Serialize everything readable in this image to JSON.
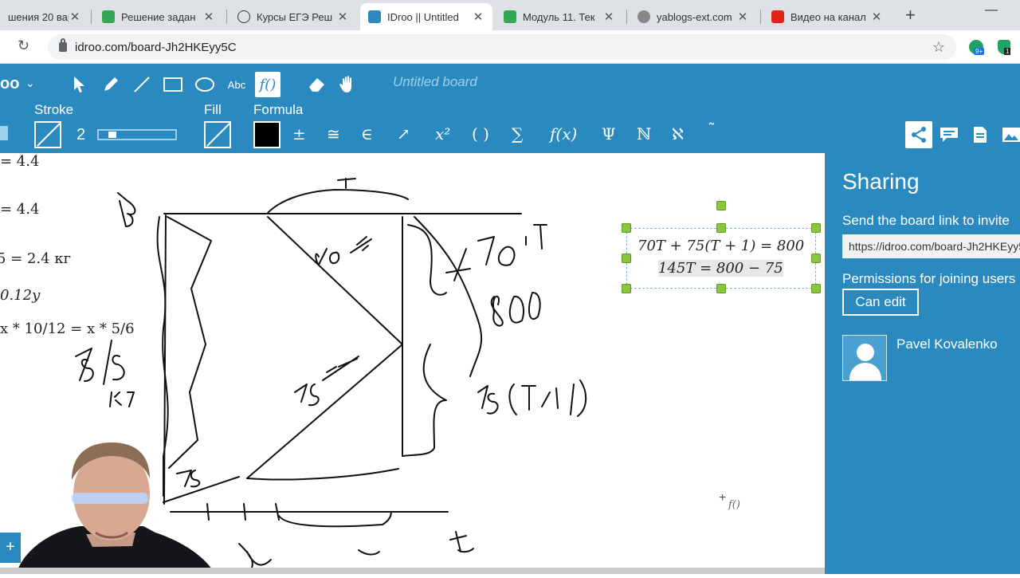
{
  "browser": {
    "tabs": [
      {
        "title": "шения 20 вар",
        "active": false
      },
      {
        "title": "Решение задан",
        "active": false
      },
      {
        "title": "Курсы ЕГЭ Реш",
        "active": false
      },
      {
        "title": "IDroo || Untitled",
        "active": true
      },
      {
        "title": "Модуль 11. Тек",
        "active": false
      },
      {
        "title": "yablogs-ext.com",
        "active": false
      },
      {
        "title": "Видео на канал",
        "active": false
      }
    ],
    "url": "idroo.com/board-Jh2HKEyy5C",
    "ext1_badge": "9+",
    "ext2_badge": "1"
  },
  "toolbar": {
    "logo": "oo",
    "text_tool": "Abc",
    "formula_tool": "f()",
    "board_title": "Untitled board",
    "stroke_label": "Stroke",
    "fill_label": "Fill",
    "formula_label": "Formula",
    "stroke_width": "2",
    "stroke_width_fraction": 0.1,
    "fill_color": "#000000",
    "symbols": [
      "±",
      "≅",
      "∈",
      "↗",
      "x²",
      "( )",
      "∑",
      "f(x)",
      "Ψ",
      "ℕ",
      "ℵ",
      "˜"
    ]
  },
  "canvas": {
    "left_formulas": [
      "= 4.4",
      "= 4.4",
      "5 = 2.4 кг",
      "0.12y",
      "x * 10/12 = x * 5/6"
    ],
    "selected_formulas": [
      "70T + 75(T + 1) = 800",
      "145T = 800 − 75"
    ],
    "cursor_label": "f()",
    "handwriting": [
      "B",
      "T",
      "70 км/ч",
      "70·T",
      "800",
      "75 км/ч",
      "75(T+1)",
      "875 км",
      "75",
      "t"
    ]
  },
  "sidebar": {
    "title": "Sharing",
    "invite_text": "Send the board link to invite",
    "link_value": "https://idroo.com/board-Jh2HKEyy5C",
    "permissions_text": "Permissions for joining users",
    "permission_button": "Can edit",
    "user_name": "Pavel Kovalenko"
  },
  "colors": {
    "accent": "#2a8ac0",
    "handle": "#8cc63f"
  }
}
